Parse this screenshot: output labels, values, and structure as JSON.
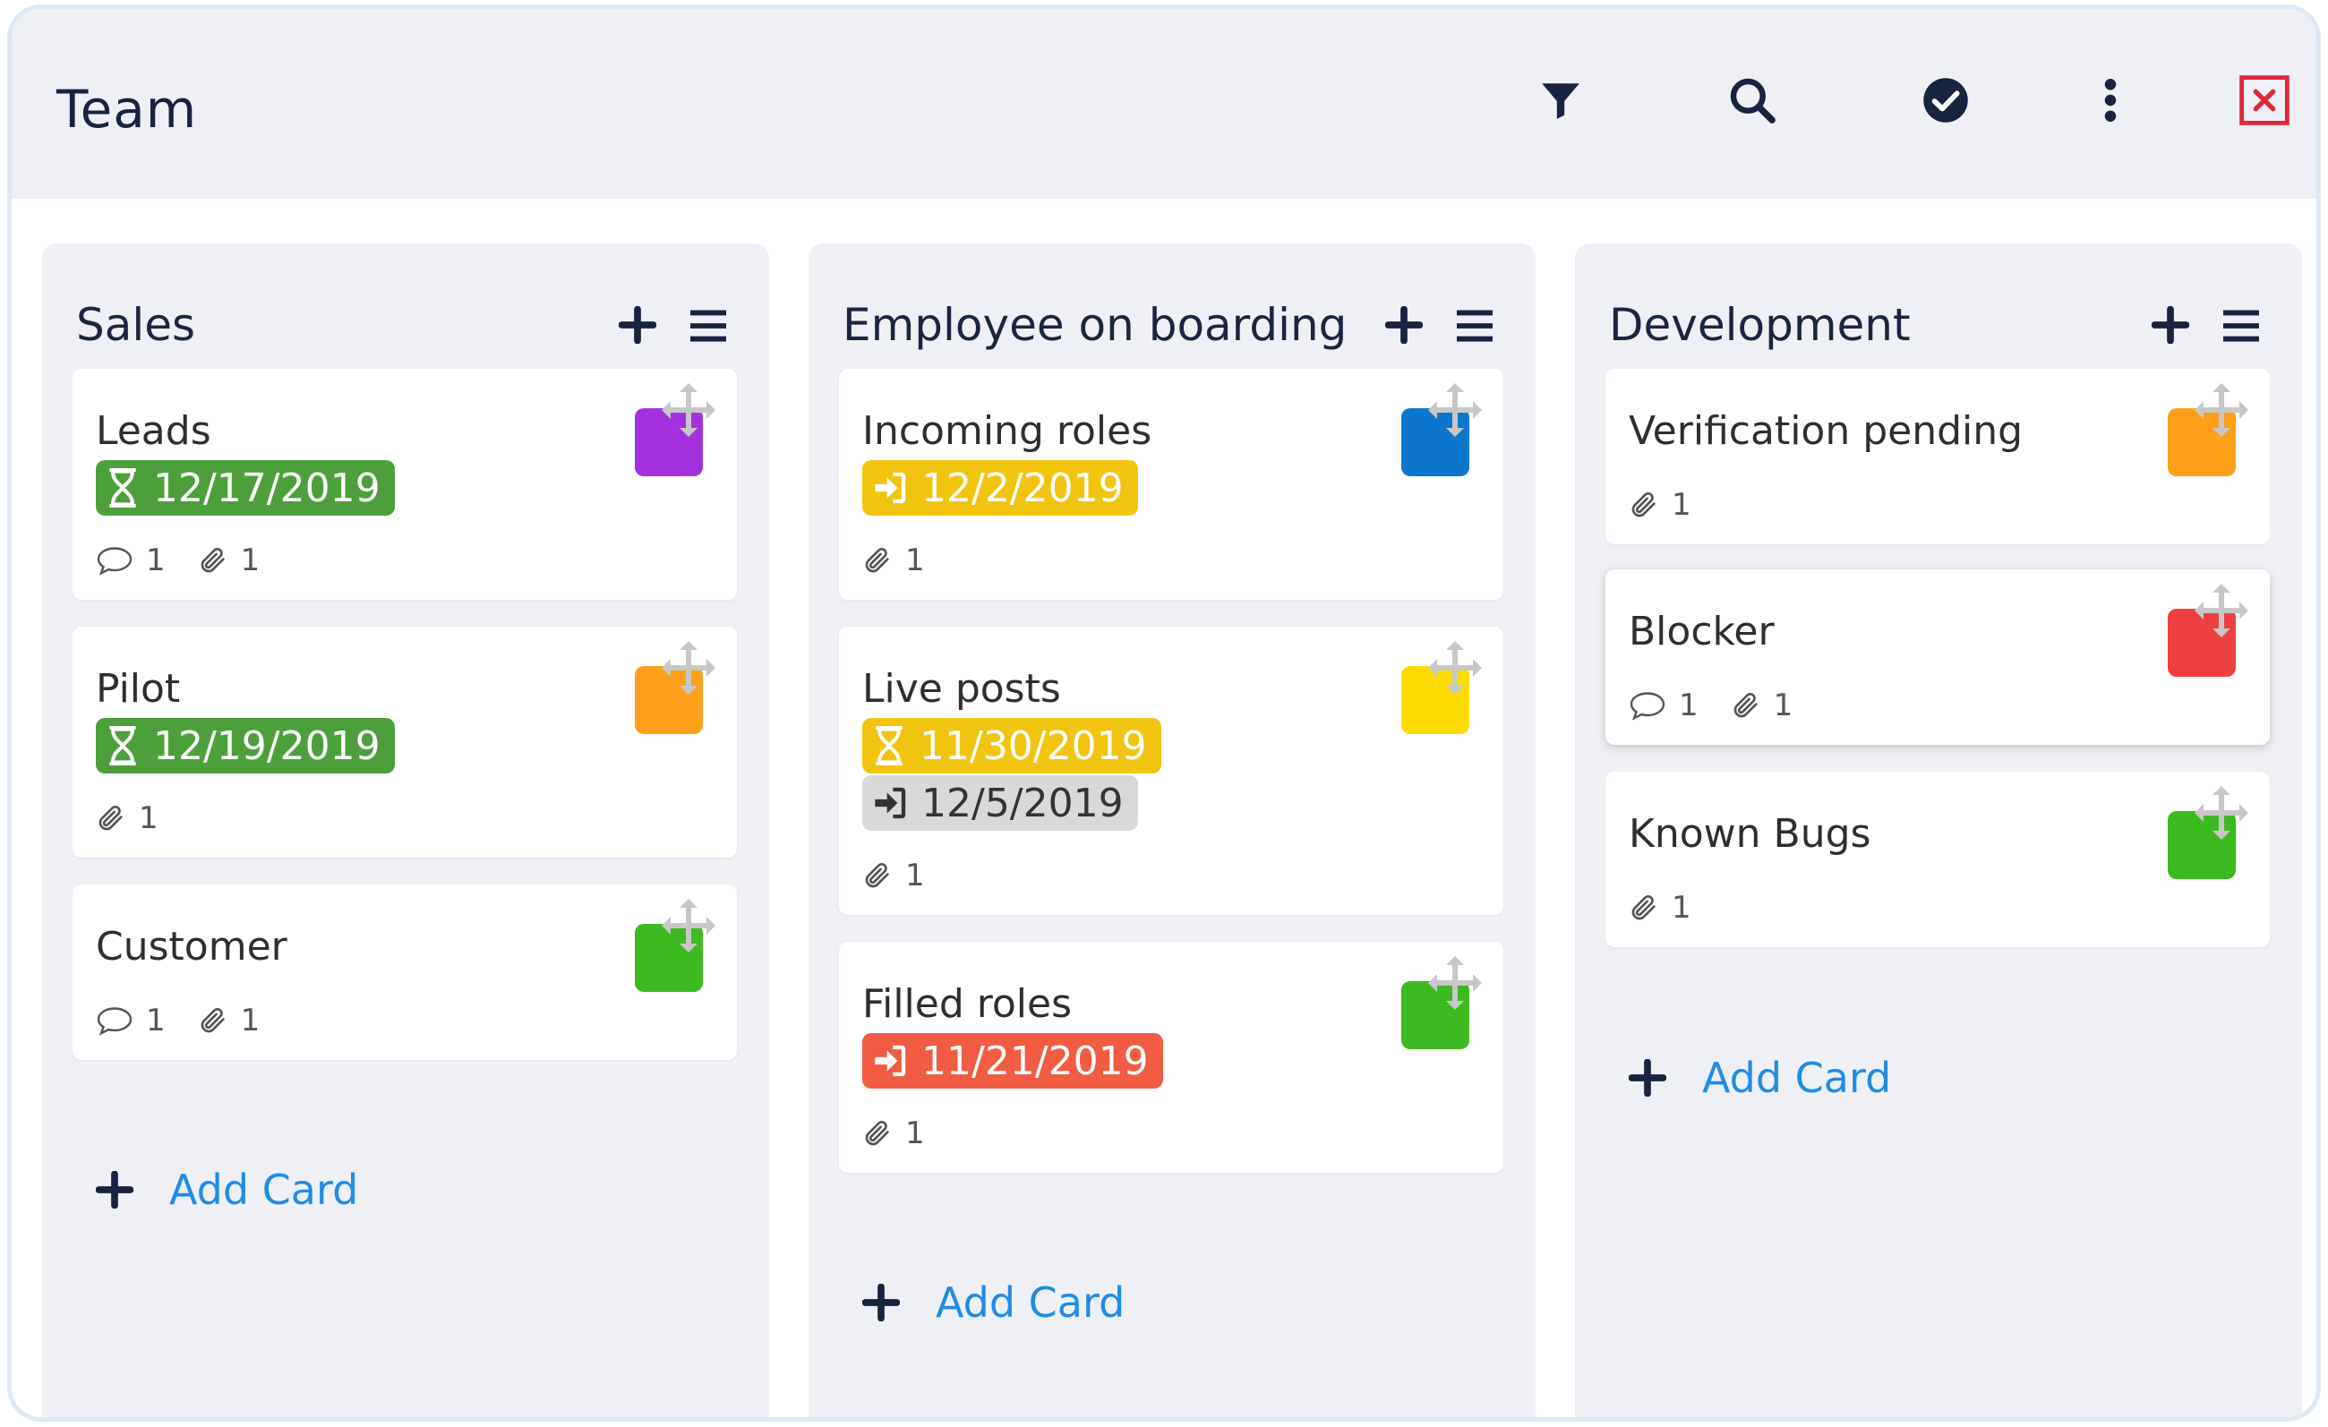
{
  "app": {
    "title": "Team"
  },
  "toolbar": {
    "filter_icon": "filter-icon",
    "search_icon": "search-icon",
    "check_icon": "check-circle-icon",
    "more_icon": "more-vertical-icon",
    "close_icon": "close-icon"
  },
  "colors": {
    "green_badge": "#4d9f3b",
    "yellow_badge": "#f1c40f",
    "red_badge": "#f25c43",
    "grey_badge": "#d9d9d9",
    "link": "#1f8ce6"
  },
  "add_card_label": "Add Card",
  "columns": [
    {
      "title": "Sales",
      "cards": [
        {
          "title": "Leads",
          "color": "#a332de",
          "badges": [
            {
              "icon": "hourglass-icon",
              "text": "12/17/2019",
              "color": "#4d9f3b"
            }
          ],
          "comments": "1",
          "attachments": "1"
        },
        {
          "title": "Pilot",
          "color": "#ff9f1a",
          "badges": [
            {
              "icon": "hourglass-icon",
              "text": "12/19/2019",
              "color": "#4d9f3b"
            }
          ],
          "attachments": "1"
        },
        {
          "title": "Customer",
          "color": "#3cba1f",
          "badges": [],
          "comments": "1",
          "attachments": "1"
        }
      ]
    },
    {
      "title": "Employee on boarding",
      "cards": [
        {
          "title": "Incoming roles",
          "color": "#0d76cc",
          "badges": [
            {
              "icon": "sign-in-icon",
              "text": "12/2/2019",
              "color": "#f1c40f"
            }
          ],
          "attachments": "1"
        },
        {
          "title": "Live posts",
          "color": "#ffdc00",
          "badges": [
            {
              "icon": "hourglass-icon",
              "text": "11/30/2019",
              "color": "#f1c40f"
            },
            {
              "icon": "sign-in-icon",
              "text": "12/5/2019",
              "color": "#d9d9d9"
            }
          ],
          "attachments": "1"
        },
        {
          "title": "Filled roles",
          "color": "#3cba1f",
          "badges": [
            {
              "icon": "sign-in-icon",
              "text": "11/21/2019",
              "color": "#f25c43"
            }
          ],
          "attachments": "1"
        }
      ]
    },
    {
      "title": "Development",
      "cards": [
        {
          "title": "Verification pending",
          "color": "#ff9f1a",
          "badges": [],
          "attachments": "1"
        },
        {
          "title": "Blocker",
          "color": "#ee4040",
          "badges": [],
          "comments": "1",
          "attachments": "1"
        },
        {
          "title": "Known Bugs",
          "color": "#3cba1f",
          "badges": [],
          "attachments": "1"
        }
      ]
    }
  ]
}
